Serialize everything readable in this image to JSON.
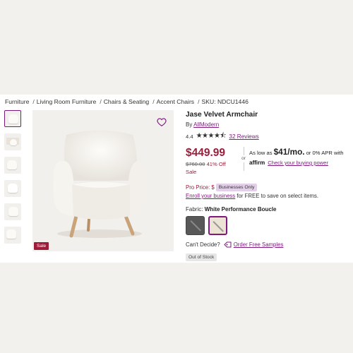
{
  "breadcrumb": {
    "items": [
      "Furniture",
      "Living Room Furniture",
      "Chairs & Seating",
      "Accent Chairs"
    ],
    "separator": "/",
    "sku": "SKU: NDCU1446"
  },
  "gallery": {
    "sale_badge": "Sale"
  },
  "product": {
    "title": "Jase Velvet Armchair",
    "by_label": "By",
    "brand": "AllModern",
    "rating": "4.4",
    "stars": "★★★★⯪",
    "reviews": "32 Reviews"
  },
  "pricing": {
    "price": "$449.99",
    "was": "$760.00",
    "off": "41% Off",
    "sale": "Sale",
    "or": "or",
    "as_low_as": "As low as",
    "monthly": "$41/mo.",
    "apr": "or 0% APR with",
    "affirm": "affirm",
    "check_power": "Check your buying power"
  },
  "pro": {
    "label": "Pro Price: $",
    "businesses_only": "Businesses Only",
    "enroll_link": "Enroll your business",
    "enroll_rest": " for FREE to save on select items."
  },
  "fabric": {
    "label": "Fabric:",
    "selected": "White Performance Boucle"
  },
  "samples": {
    "question": "Can't Decide?",
    "link": "Order Free Samples"
  },
  "stock": {
    "status": "Out of Stock"
  },
  "colors": {
    "accent": "#7f187f",
    "price": "#9c1c3a"
  }
}
